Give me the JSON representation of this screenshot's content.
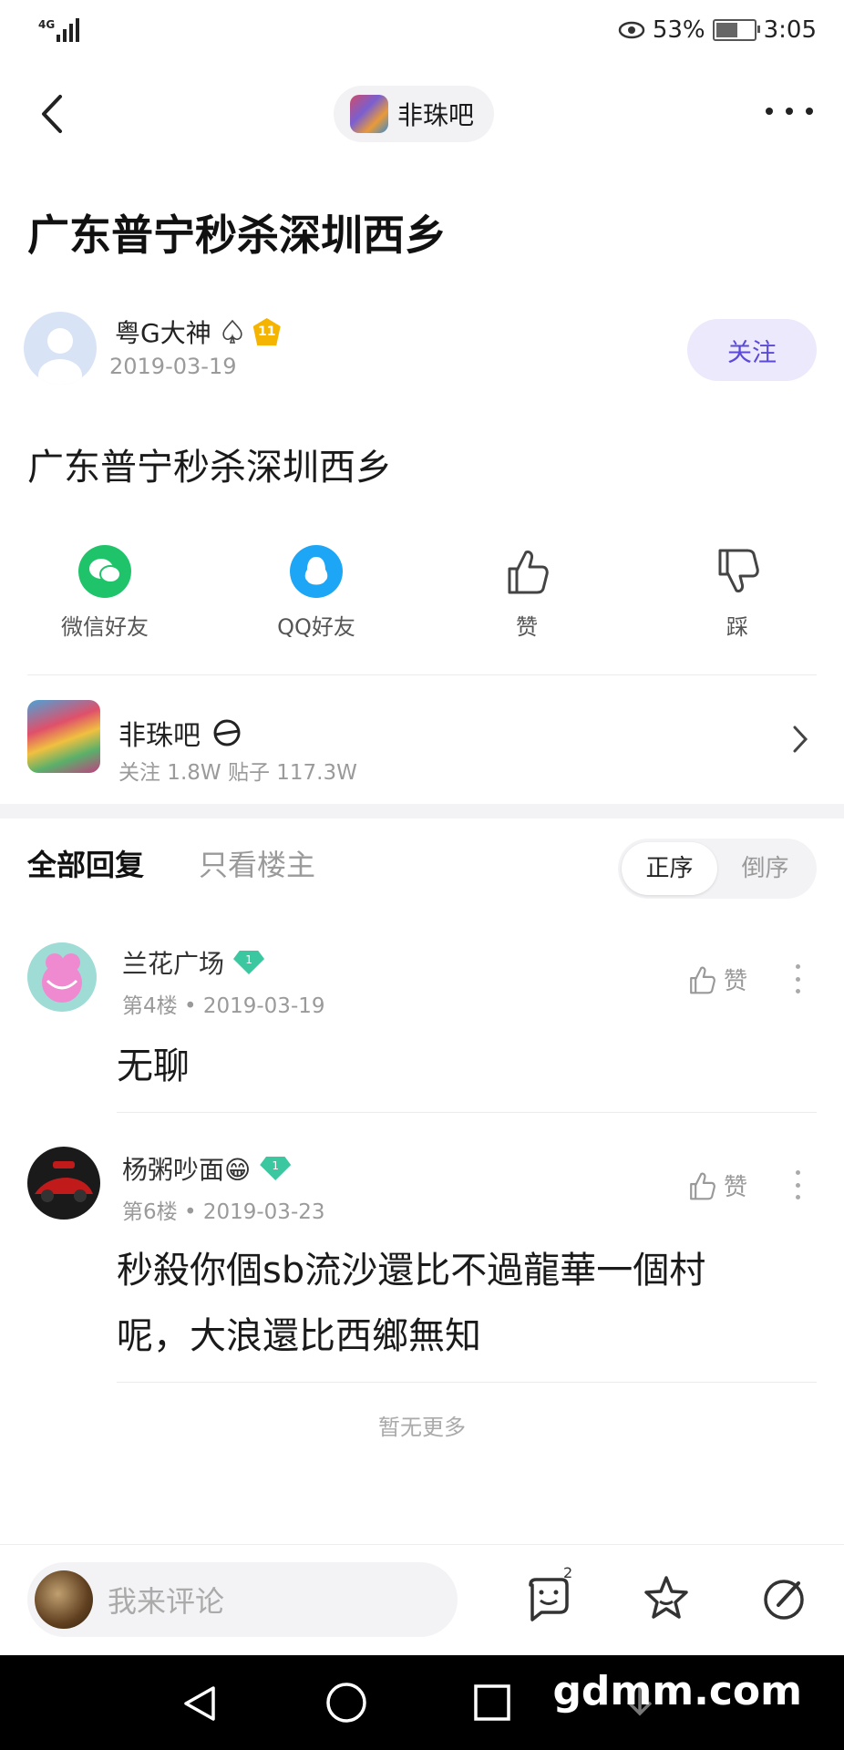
{
  "status_bar": {
    "network": "4G",
    "battery": "53%",
    "time": "3:05",
    "battery_level": 0.53
  },
  "nav": {
    "forum_name": "非珠吧"
  },
  "post": {
    "title": "广东普宁秒杀深圳西乡",
    "author": {
      "name": "粤G大神",
      "level": "11",
      "date": "2019-03-19"
    },
    "follow_label": "关注",
    "content": "广东普宁秒杀深圳西乡"
  },
  "share": [
    {
      "label": "微信好友",
      "icon": "wechat-icon"
    },
    {
      "label": "QQ好友",
      "icon": "qq-icon"
    },
    {
      "label": "赞",
      "icon": "thumb-up-icon"
    },
    {
      "label": "踩",
      "icon": "thumb-down-icon"
    }
  ],
  "forum_card": {
    "name": "非珠吧",
    "stats": "关注 1.8W   贴子 117.3W"
  },
  "replies_header": {
    "tab_all": "全部回复",
    "tab_owner": "只看楼主",
    "sort_asc": "正序",
    "sort_desc": "倒序"
  },
  "replies": [
    {
      "name": "兰花广场",
      "level": "1",
      "floor": "第4楼",
      "date": "2019-03-19",
      "like_label": "赞",
      "content": "无聊"
    },
    {
      "name": "杨粥吵面😁",
      "level": "1",
      "floor": "第6楼",
      "date": "2019-03-23",
      "like_label": "赞",
      "content_line1": "秒殺你個sb流沙還比不過龍華一個村",
      "content_line2": "呢，大浪還比西鄉無知"
    }
  ],
  "no_more": "暂无更多",
  "bottom_bar": {
    "comment_placeholder": "我来评论",
    "emoji_badge": "2"
  },
  "watermark": "gdmm.com",
  "colors": {
    "accent": "#5b4ad8",
    "wechat": "#1fc46a",
    "qq": "#1da6f5",
    "gem": "#3bc7a0",
    "gold": "#f5b400"
  }
}
